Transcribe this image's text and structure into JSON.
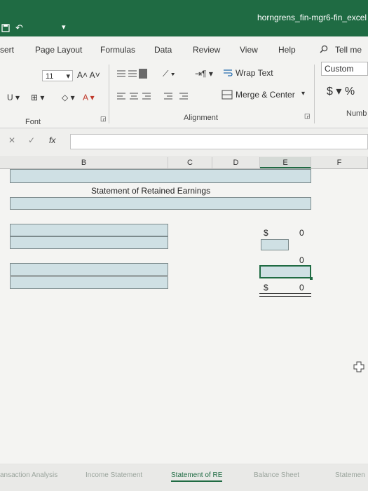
{
  "window": {
    "title": "horngrens_fin-mgr6-fin_excel"
  },
  "qat": {
    "undo": "↶",
    "customize": "▾"
  },
  "menu": [
    "sert",
    "Page Layout",
    "Formulas",
    "Data",
    "Review",
    "View",
    "Help"
  ],
  "search": {
    "label": "Tell me"
  },
  "ribbon": {
    "font_size": "11",
    "font_size_arrow": "▾",
    "grow_shrink": "A˄ A˅",
    "underline": "U ▾",
    "border": "⊞ ▾",
    "fill_color": "◇ ▾",
    "font_color": "A ▾",
    "wrap_text": "Wrap Text",
    "merge_center": "Merge & Center",
    "merge_arrow": "▾",
    "number_format": "Custom",
    "currency": "$ ▾ %",
    "orientation": "⟋ ▾",
    "indent": "⇥¶ ▾",
    "group_font": "Font",
    "group_alignment": "Alignment",
    "group_number": "Numb"
  },
  "formula_bar": {
    "cancel": "✕",
    "enter": "✓",
    "fx": "fx",
    "value": ""
  },
  "columns": [
    "B",
    "C",
    "D",
    "E",
    "F"
  ],
  "sheet": {
    "title": "Statement of Retained Earnings",
    "row1": {
      "symbol": "$",
      "value": "0"
    },
    "row2": {
      "value": "0"
    },
    "row3": {
      "symbol": "$",
      "value": "0"
    }
  },
  "tabs": [
    "ansaction Analysis",
    "Income Statement",
    "Statement of RE",
    "Balance Sheet",
    "Statemen"
  ],
  "colors": {
    "title_bar": "#1f6b43",
    "input_band": "#cfe0e4",
    "active_tab": "#1f6b43"
  },
  "cursor": "cell-select-cross"
}
